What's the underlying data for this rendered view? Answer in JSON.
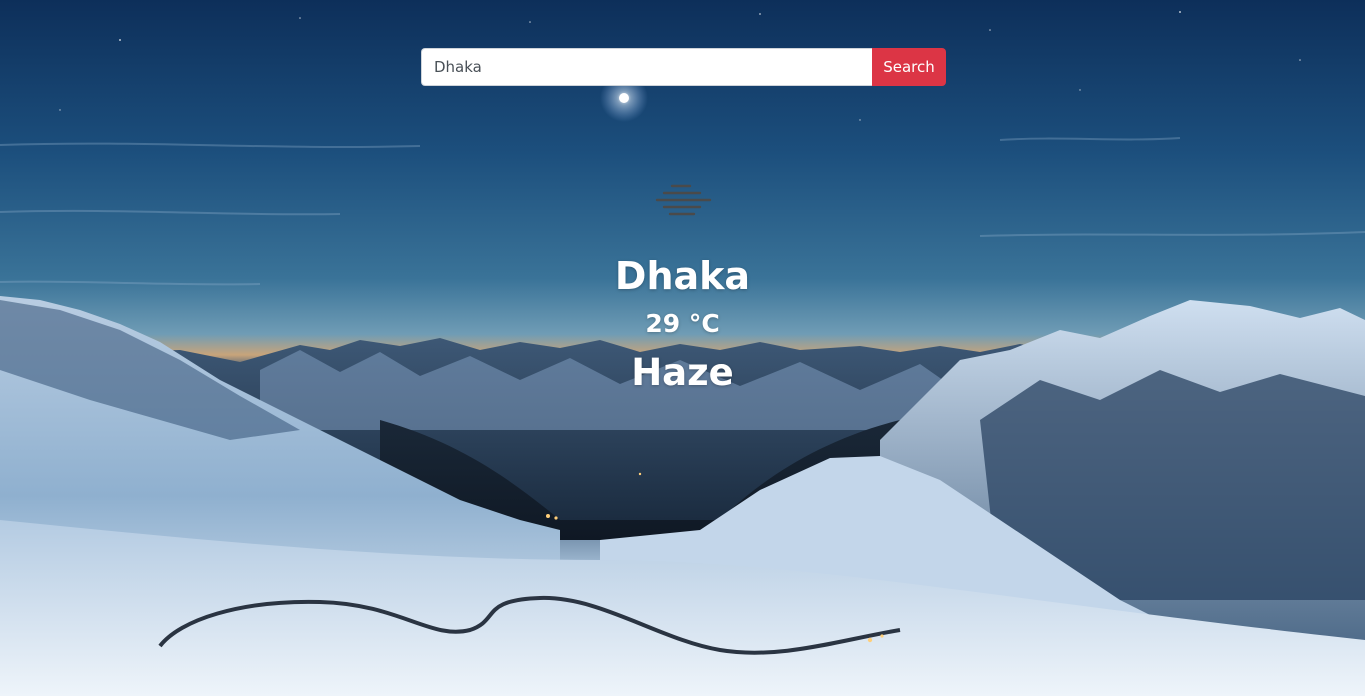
{
  "search": {
    "value": "Dhaka",
    "button_label": "Search"
  },
  "weather": {
    "icon": "haze-icon",
    "city": "Dhaka",
    "temperature": "29 °C",
    "condition": "Haze"
  },
  "colors": {
    "button": "#dc3545",
    "text": "#ffffff",
    "icon": "#4a4a4a"
  }
}
